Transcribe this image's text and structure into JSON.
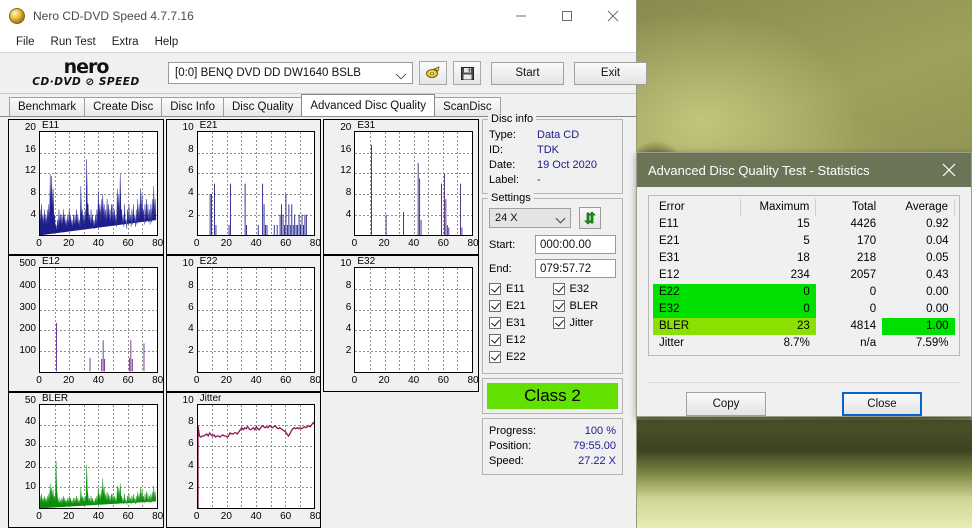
{
  "window": {
    "title": "Nero CD-DVD Speed 4.7.7.16",
    "icon": "disc-icon",
    "minimize": "—",
    "maximize": "□",
    "close": "✕"
  },
  "menu": [
    {
      "label": "File"
    },
    {
      "label": "Run Test"
    },
    {
      "label": "Extra"
    },
    {
      "label": "Help"
    }
  ],
  "toolbar": {
    "logo_line1": "nero",
    "logo_line2": "CD·DVD ⊘ SPEED",
    "drive": "[0:0]   BENQ DVD DD DW1640 BSLB",
    "eject_icon": "eject-disc-icon",
    "save_icon": "floppy-save-icon",
    "start_label": "Start",
    "exit_label": "Exit"
  },
  "tabs": [
    {
      "label": "Benchmark",
      "active": false
    },
    {
      "label": "Create Disc",
      "active": false
    },
    {
      "label": "Disc Info",
      "active": false
    },
    {
      "label": "Disc Quality",
      "active": false
    },
    {
      "label": "Advanced Disc Quality",
      "active": true
    },
    {
      "label": "ScanDisc",
      "active": false
    }
  ],
  "disc_info": {
    "legend": "Disc info",
    "rows": [
      {
        "key": "Type:",
        "value": "Data CD"
      },
      {
        "key": "ID:",
        "value": "TDK"
      },
      {
        "key": "Date:",
        "value": "19 Oct 2020"
      },
      {
        "key": "Label:",
        "value": "-"
      }
    ]
  },
  "settings": {
    "legend": "Settings",
    "speed": "24 X",
    "refresh_icon": "refresh-arrows-icon",
    "start_label": "Start:",
    "start_value": "000:00.00",
    "end_label": "End:",
    "end_value": "079:57.72",
    "checkboxes_left": [
      "E11",
      "E21",
      "E31",
      "E12",
      "E22"
    ],
    "checkboxes_right": [
      "E32",
      "BLER",
      "Jitter"
    ]
  },
  "class": {
    "label": "Class 2",
    "color": "#62e000"
  },
  "progress": {
    "rows": [
      {
        "key": "Progress:",
        "value": "100 %"
      },
      {
        "key": "Position:",
        "value": "79:55.00"
      },
      {
        "key": "Speed:",
        "value": "27.22 X"
      }
    ]
  },
  "stats_dialog": {
    "title": "Advanced Disc Quality Test - Statistics",
    "close_icon": "close-icon",
    "headers": [
      "Error",
      "Maximum",
      "Total",
      "Average"
    ],
    "rows": [
      {
        "error": "E11",
        "maximum": "15",
        "total": "4426",
        "average": "0.92",
        "hl": "none"
      },
      {
        "error": "E21",
        "maximum": "5",
        "total": "170",
        "average": "0.04",
        "hl": "none"
      },
      {
        "error": "E31",
        "maximum": "18",
        "total": "218",
        "average": "0.05",
        "hl": "none"
      },
      {
        "error": "E12",
        "maximum": "234",
        "total": "2057",
        "average": "0.43",
        "hl": "none"
      },
      {
        "error": "E22",
        "maximum": "0",
        "total": "0",
        "average": "0.00",
        "hl": "green-left"
      },
      {
        "error": "E32",
        "maximum": "0",
        "total": "0",
        "average": "0.00",
        "hl": "green-left"
      },
      {
        "error": "BLER",
        "maximum": "23",
        "total": "4814",
        "average": "1.00",
        "hl": "ylwgreen-left-green-avg"
      },
      {
        "error": "Jitter",
        "maximum": "8.7%",
        "total": "n/a",
        "average": "7.59%",
        "hl": "none"
      }
    ],
    "copy_label": "Copy",
    "close_label": "Close",
    "colors": {
      "green": "#00e000",
      "yellow_green": "#8ae000",
      "title_bar": "#6c7458"
    }
  },
  "chart_data": [
    {
      "type": "area",
      "title": "E11",
      "color": "#1d1d8c",
      "xlabel": "",
      "ylabel": "",
      "xlim": [
        0,
        80
      ],
      "ylim": [
        0,
        20
      ],
      "xticks": [
        0,
        20,
        40,
        60,
        80
      ],
      "yticks": [
        4,
        8,
        12,
        16,
        20
      ],
      "grid": true,
      "x": [
        0,
        1,
        2,
        3,
        4,
        5,
        6,
        7,
        8,
        9,
        10,
        11,
        12,
        13,
        14,
        15,
        16,
        17,
        18,
        19,
        20,
        21,
        22,
        23,
        24,
        25,
        26,
        27,
        28,
        29,
        30,
        31,
        32,
        33,
        34,
        35,
        36,
        37,
        38,
        39,
        40,
        41,
        42,
        43,
        44,
        45,
        46,
        47,
        48,
        49,
        50,
        51,
        52,
        53,
        54,
        55,
        56,
        57,
        58,
        59,
        60,
        61,
        62,
        63,
        64,
        65,
        66,
        67,
        68,
        69,
        70,
        71,
        72,
        73,
        74,
        75,
        76,
        77,
        78,
        79,
        80
      ],
      "values": [
        5,
        6,
        4,
        5,
        4,
        5,
        6,
        11.8,
        11.5,
        9,
        4,
        2,
        3,
        5,
        4,
        4,
        5,
        4,
        3,
        4,
        5,
        4,
        3,
        4,
        4,
        5,
        4,
        3,
        9.5,
        5,
        4,
        5,
        14.7,
        6,
        4,
        5,
        4,
        3,
        4,
        5,
        8.5,
        6,
        7,
        8,
        6,
        5,
        7,
        6,
        5,
        6,
        6,
        5,
        4,
        9,
        8,
        11.9,
        5,
        4,
        6,
        3,
        5,
        6,
        4,
        5,
        6,
        4,
        5,
        7,
        6,
        9,
        8,
        5,
        6,
        7,
        6,
        5,
        6,
        7,
        9.5,
        7
      ]
    },
    {
      "type": "bar",
      "title": "E21",
      "color": "#1d1d8c",
      "xlim": [
        0,
        80
      ],
      "ylim": [
        0,
        10
      ],
      "xticks": [
        0,
        20,
        40,
        60,
        80
      ],
      "yticks": [
        2,
        4,
        6,
        8,
        10
      ],
      "grid": true,
      "x": [
        8,
        9,
        11,
        12,
        21,
        22,
        32,
        33,
        41,
        44,
        45,
        46,
        47,
        52,
        54,
        56,
        57,
        58,
        59,
        60,
        61,
        62,
        63,
        64,
        65,
        66,
        67,
        68,
        69,
        70,
        71,
        72,
        73,
        74
      ],
      "values": [
        4,
        4,
        5,
        1,
        1,
        5,
        5,
        1,
        1,
        5,
        3,
        1,
        1,
        1,
        1,
        2,
        3,
        2,
        1,
        4,
        1,
        3,
        1,
        3,
        1,
        2,
        1,
        1,
        2,
        1,
        2,
        1,
        2,
        2
      ]
    },
    {
      "type": "bar",
      "title": "E31",
      "color": "#3d1d7a",
      "xlim": [
        0,
        80
      ],
      "ylim": [
        0,
        20
      ],
      "xticks": [
        0,
        20,
        40,
        60,
        80
      ],
      "yticks": [
        4,
        8,
        12,
        16,
        20
      ],
      "grid": true,
      "x": [
        11,
        21,
        33,
        43,
        44,
        45,
        59,
        61,
        62,
        63,
        64,
        72,
        73
      ],
      "values": [
        17.5,
        4,
        4.5,
        14,
        11,
        3,
        10,
        12,
        7,
        2,
        1.5,
        10,
        1.5
      ]
    },
    {
      "type": "bar",
      "title": "E12",
      "color": "#6b1f8c",
      "xlim": [
        0,
        80
      ],
      "ylim": [
        0,
        500
      ],
      "xticks": [
        0,
        20,
        40,
        60,
        80
      ],
      "yticks": [
        100,
        200,
        300,
        400,
        500
      ],
      "grid": true,
      "x": [
        11,
        34,
        42,
        43,
        44,
        61,
        62,
        63,
        71
      ],
      "values": [
        234,
        65,
        60,
        150,
        60,
        65,
        150,
        60,
        135
      ]
    },
    {
      "type": "bar",
      "title": "E22",
      "color": "#1d1d8c",
      "xlim": [
        0,
        80
      ],
      "ylim": [
        0,
        10
      ],
      "xticks": [
        0,
        20,
        40,
        60,
        80
      ],
      "yticks": [
        2,
        4,
        6,
        8,
        10
      ],
      "grid": true,
      "x": [],
      "values": []
    },
    {
      "type": "bar",
      "title": "E32",
      "color": "#1d1d8c",
      "xlim": [
        0,
        80
      ],
      "ylim": [
        0,
        10
      ],
      "xticks": [
        0,
        20,
        40,
        60,
        80
      ],
      "yticks": [
        2,
        4,
        6,
        8,
        10
      ],
      "grid": true,
      "x": [],
      "values": []
    },
    {
      "type": "area",
      "title": "BLER",
      "color": "#0a8f0a",
      "xlim": [
        0,
        80
      ],
      "ylim": [
        0,
        50
      ],
      "xticks": [
        0,
        20,
        40,
        60,
        80
      ],
      "yticks": [
        10,
        20,
        30,
        40,
        50
      ],
      "grid": true,
      "x": [
        0,
        1,
        2,
        3,
        4,
        5,
        6,
        7,
        8,
        9,
        10,
        11,
        12,
        13,
        14,
        15,
        16,
        17,
        18,
        19,
        20,
        21,
        22,
        23,
        24,
        25,
        26,
        27,
        28,
        29,
        30,
        31,
        32,
        33,
        34,
        35,
        36,
        37,
        38,
        39,
        40,
        41,
        42,
        43,
        44,
        45,
        46,
        47,
        48,
        49,
        50,
        51,
        52,
        53,
        54,
        55,
        56,
        57,
        58,
        59,
        60,
        61,
        62,
        63,
        64,
        65,
        66,
        67,
        68,
        69,
        70,
        71,
        72,
        73,
        74,
        75,
        76,
        77,
        78,
        79,
        80
      ],
      "values": [
        6,
        7,
        5,
        6,
        5,
        6,
        7,
        12,
        10,
        9,
        6,
        23,
        5,
        5,
        4,
        5,
        6,
        5,
        4,
        5,
        6,
        5,
        4,
        5,
        5,
        6,
        5,
        4,
        10,
        6,
        5,
        6,
        21,
        6,
        5,
        6,
        5,
        4,
        5,
        6,
        10,
        7,
        9,
        14.5,
        10,
        7,
        8,
        7,
        6,
        7,
        7,
        6,
        5,
        11,
        10,
        12,
        6,
        5,
        7,
        4,
        6,
        7,
        5,
        6,
        7,
        5,
        6,
        8,
        7,
        10,
        9,
        6,
        7,
        8,
        7,
        6,
        7,
        8,
        11,
        8
      ]
    },
    {
      "type": "line",
      "title": "Jitter",
      "color": "#8c1752",
      "xlim": [
        0,
        80
      ],
      "ylim": [
        0,
        10
      ],
      "xticks": [
        0,
        20,
        40,
        60,
        80
      ],
      "yticks": [
        2,
        4,
        6,
        8,
        10
      ],
      "grid": true,
      "x": [
        0,
        1,
        2,
        3,
        4,
        5,
        6,
        7,
        8,
        9,
        10,
        11,
        12,
        13,
        14,
        15,
        16,
        17,
        18,
        19,
        20,
        21,
        22,
        23,
        24,
        25,
        26,
        27,
        28,
        29,
        30,
        31,
        32,
        33,
        34,
        35,
        36,
        37,
        38,
        39,
        40,
        41,
        42,
        43,
        44,
        45,
        46,
        47,
        48,
        49,
        50,
        51,
        52,
        53,
        54,
        55,
        56,
        57,
        58,
        59,
        60,
        61,
        62,
        63,
        64,
        65,
        66,
        67,
        68,
        69,
        70,
        71,
        72,
        73,
        74,
        75,
        76,
        77,
        78,
        79,
        80
      ],
      "values": [
        8.0,
        7.0,
        6.9,
        7.0,
        7.0,
        7.1,
        7.2,
        7.0,
        7.3,
        7.1,
        7.0,
        7.1,
        6.9,
        7.0,
        7.0,
        6.9,
        7.0,
        7.1,
        7.0,
        7.0,
        6.9,
        7.0,
        7.3,
        7.2,
        7.2,
        7.3,
        7.3,
        7.2,
        7.4,
        7.6,
        7.8,
        7.6,
        7.8,
        7.7,
        7.9,
        7.7,
        7.6,
        7.7,
        7.8,
        7.6,
        7.9,
        7.7,
        7.6,
        7.8,
        8.0,
        7.9,
        7.8,
        7.9,
        7.8,
        8.0,
        7.9,
        7.8,
        7.9,
        8.0,
        7.8,
        7.7,
        7.8,
        7.7,
        7.6,
        7.5,
        7.4,
        7.2,
        7.0,
        7.2,
        7.5,
        7.7,
        7.8,
        7.7,
        7.8,
        7.7,
        7.8,
        7.7,
        7.8,
        7.9,
        7.8,
        7.9,
        8.0,
        7.9,
        8.1,
        8.3,
        8.1
      ]
    }
  ]
}
